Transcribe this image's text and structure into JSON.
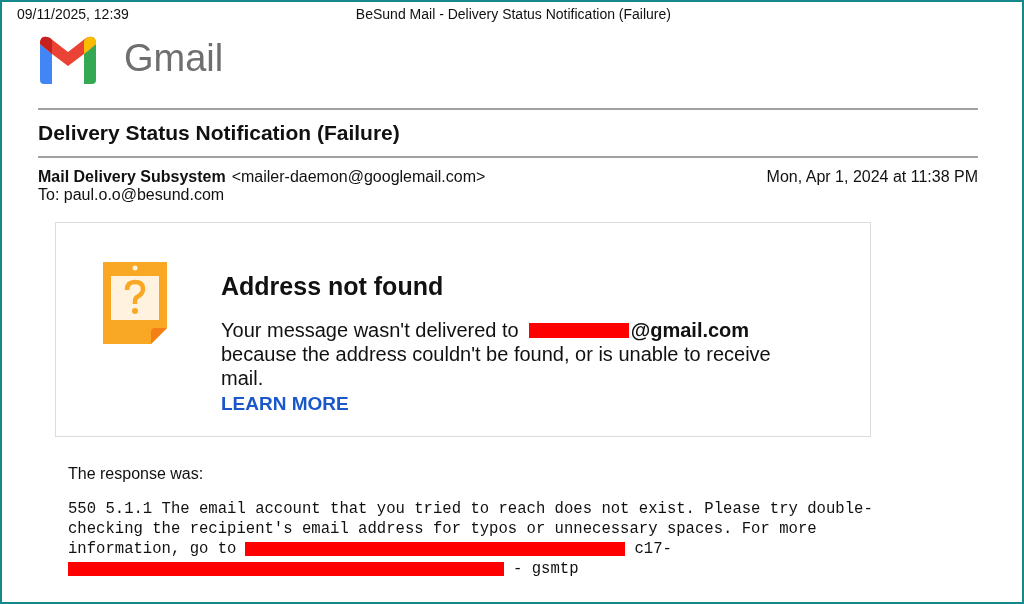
{
  "print_header": {
    "date": "09/11/2025, 12:39",
    "title": "BeSund Mail - Delivery Status Notification (Failure)"
  },
  "logo": {
    "wordmark": "Gmail"
  },
  "subject": "Delivery Status Notification (Failure)",
  "sender": {
    "name": "Mail Delivery Subsystem",
    "address": "<mailer-daemon@googlemail.com>",
    "date": "Mon, Apr 1, 2024 at 11:38 PM",
    "to": "To: paul.o.o@besund.com"
  },
  "notice": {
    "title": "Address not found",
    "message_start": "Your message wasn't delivered to",
    "domain": "@gmail.com",
    "message_end": "because the address couldn't be found, or is unable to receive mail.",
    "link": "LEARN MORE"
  },
  "response_label": "The response was:",
  "response_lines": [
    {
      "parts": [
        {
          "kind": "text",
          "text": "550 5.1.1 The email account that you tried to reach does not exist. Please try double-"
        }
      ]
    },
    {
      "parts": [
        {
          "kind": "text",
          "text": "checking the recipient's email address for typos or unnecessary spaces. For more"
        }
      ]
    },
    {
      "parts": [
        {
          "kind": "text",
          "text": "information, go to"
        },
        {
          "kind": "redaction"
        },
        {
          "kind": "text",
          "text": "c17-"
        }
      ]
    },
    {
      "parts": [
        {
          "kind": "redaction"
        },
        {
          "kind": "text",
          "text": "- gsmtp"
        }
      ]
    }
  ]
}
